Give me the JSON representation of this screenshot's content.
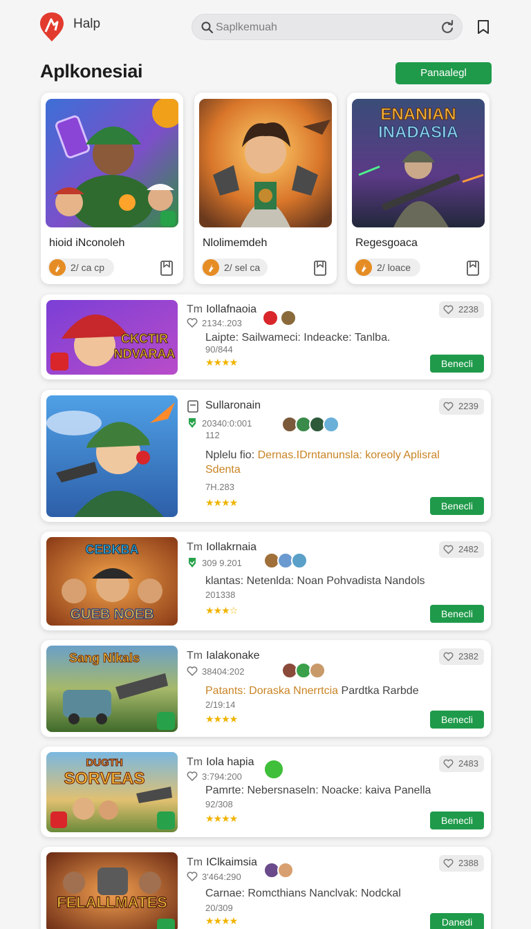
{
  "header": {
    "brand": "Halp",
    "search_placeholder": "Saplkemuah"
  },
  "page": {
    "title": "Aplkonesiai",
    "primary_button": "Panaalegl"
  },
  "featured": [
    {
      "title": "hioid iNconoleh",
      "chip": "2/ ca cp"
    },
    {
      "title": "Nlolimemdeh",
      "chip": "2/ sel ca"
    },
    {
      "title": "Regesgoaca",
      "chip": "2/ loace"
    }
  ],
  "featured_art_text": [
    "ENANIAN",
    "INADASIA"
  ],
  "rows": [
    {
      "prefix": "Tm",
      "title": "Iollafnaoia",
      "meta": "2134:.203",
      "meta2": "90/844",
      "desc_prefix": "Laipte: Sailwameci: Indeacke: Tanlba.",
      "desc_hl": "",
      "desc_rest": "",
      "sub": "",
      "stars": "★★★★",
      "likes": "2238",
      "action": "Benecli",
      "art": [
        "CKCTIR",
        "NDVARAA"
      ]
    },
    {
      "prefix": "",
      "title": "Sullaronain",
      "meta": "20340:0:001",
      "meta2": "112",
      "desc_prefix": "Nplelu fio:",
      "desc_hl": "Dernas.IDrntanunsla: koreoly Aplisral Sdenta",
      "desc_rest": "",
      "sub": "7H.283",
      "stars": "★★★★",
      "likes": "2239",
      "action": "Benecli",
      "art": []
    },
    {
      "prefix": "Tm",
      "title": "Iollakrnaia",
      "meta": "309 9.201",
      "meta2": "",
      "desc_prefix": "klantas: Netenlda: Noan Pohvadista Nandols",
      "desc_hl": "",
      "desc_rest": "",
      "sub": "201338",
      "stars": "★★★☆",
      "likes": "2482",
      "action": "Benecli",
      "art": [
        "CEBKBA",
        "GUEB NOEB"
      ]
    },
    {
      "prefix": "Tm",
      "title": "Ialakonake",
      "meta": "38404:202",
      "meta2": "",
      "desc_prefix": "",
      "desc_hl": "Patants: Doraska Nnerrtcia",
      "desc_rest": "Pardtka Rarbde",
      "sub": "2/19:14",
      "stars": "★★★★",
      "likes": "2382",
      "action": "Benecli",
      "art": [
        "Sang Nikals"
      ]
    },
    {
      "prefix": "Tm",
      "title": "Iola hapia",
      "meta": "3:794:200",
      "meta2": "",
      "desc_prefix": "Pamrte: Nebersnaseln: Noacke: kaiva Panella",
      "desc_hl": "",
      "desc_rest": "",
      "sub": "92/308",
      "stars": "★★★★",
      "likes": "2483",
      "action": "Benecli",
      "art": [
        "DUGTH",
        "SORVEAS"
      ]
    },
    {
      "prefix": "Tm",
      "title": "IClkaimsia",
      "meta": "3'464:290",
      "meta2": "",
      "desc_prefix": "Carnae: Romcthians Nanclvak: Nodckal",
      "desc_hl": "",
      "desc_rest": "",
      "sub": "20/309",
      "stars": "★★★★",
      "likes": "2388",
      "action": "Danedi",
      "art": [
        "FELALLMATES"
      ]
    }
  ],
  "colors": {
    "accent": "#1f9a4a",
    "star": "#f0b400",
    "highlight": "#c98424",
    "brand_red": "#e23b2e"
  }
}
